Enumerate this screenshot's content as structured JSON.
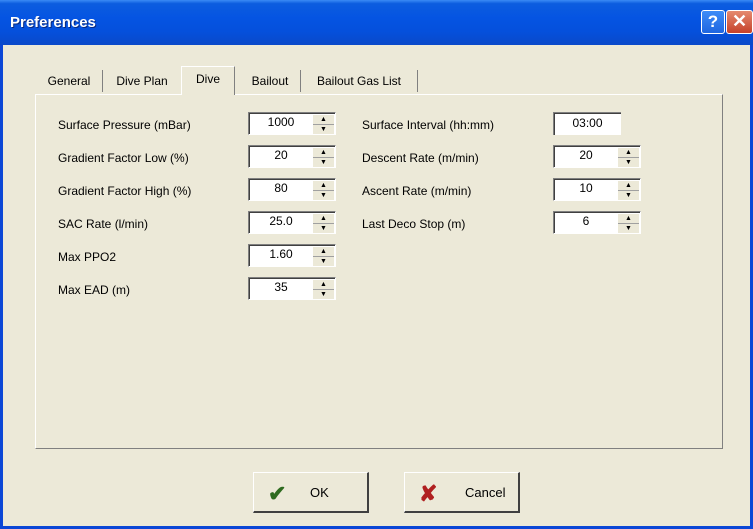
{
  "window": {
    "title": "Preferences",
    "help_label": "?",
    "close_label": "✕"
  },
  "tabs": [
    {
      "label": "General"
    },
    {
      "label": "Dive Plan"
    },
    {
      "label": "Dive"
    },
    {
      "label": "Bailout"
    },
    {
      "label": "Bailout Gas List"
    }
  ],
  "fields": {
    "surface_pressure": {
      "label": "Surface Pressure (mBar)",
      "value": "1000"
    },
    "gf_low": {
      "label": "Gradient Factor Low (%)",
      "value": "20"
    },
    "gf_high": {
      "label": "Gradient Factor High (%)",
      "value": "80"
    },
    "sac_rate": {
      "label": "SAC Rate (l/min)",
      "value": "25.0"
    },
    "max_ppo2": {
      "label": "Max PPO2",
      "value": "1.60"
    },
    "max_ead": {
      "label": "Max EAD (m)",
      "value": "35"
    },
    "surface_interval": {
      "label": "Surface Interval (hh:mm)",
      "value": "03:00"
    },
    "descent_rate": {
      "label": "Descent Rate (m/min)",
      "value": "20"
    },
    "ascent_rate": {
      "label": "Ascent Rate (m/min)",
      "value": "10"
    },
    "last_deco_stop": {
      "label": "Last Deco Stop (m)",
      "value": "6"
    }
  },
  "buttons": {
    "ok": "OK",
    "cancel": "Cancel"
  },
  "colors": {
    "titlebar": "#0554e2",
    "dialog_bg": "#ece9d8",
    "ok_icon": "#2e6b1f",
    "cancel_icon": "#b02020"
  },
  "icons": {
    "ok": "checkmark-icon",
    "cancel": "x-icon"
  }
}
